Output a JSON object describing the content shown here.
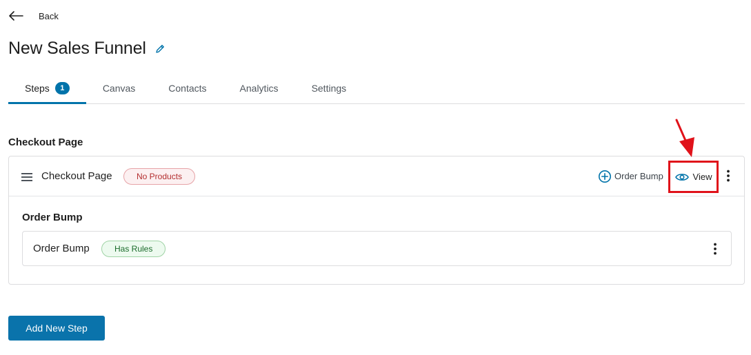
{
  "header": {
    "back_label": "Back",
    "title": "New Sales Funnel"
  },
  "tabs": [
    {
      "label": "Steps",
      "count": "1",
      "active": true
    },
    {
      "label": "Canvas",
      "active": false
    },
    {
      "label": "Contacts",
      "active": false
    },
    {
      "label": "Analytics",
      "active": false
    },
    {
      "label": "Settings",
      "active": false
    }
  ],
  "section": {
    "heading": "Checkout Page"
  },
  "step": {
    "name": "Checkout Page",
    "badge": "No Products",
    "order_bump_action": "Order Bump",
    "view_action": "View",
    "order_bump_section": {
      "heading": "Order Bump",
      "item_name": "Order Bump",
      "item_badge": "Has Rules"
    }
  },
  "actions": {
    "add_new_step": "Add New Step"
  },
  "colors": {
    "accent": "#0073aa",
    "annotation": "#e0121a",
    "badge_red": "#b32d2e",
    "badge_green": "#1a6b2a"
  },
  "icons": {
    "back": "arrow-left-icon",
    "edit": "pencil-icon",
    "drag": "drag-handle-icon",
    "add": "plus-circle-icon",
    "view": "eye-icon",
    "more": "kebab-menu-icon"
  }
}
